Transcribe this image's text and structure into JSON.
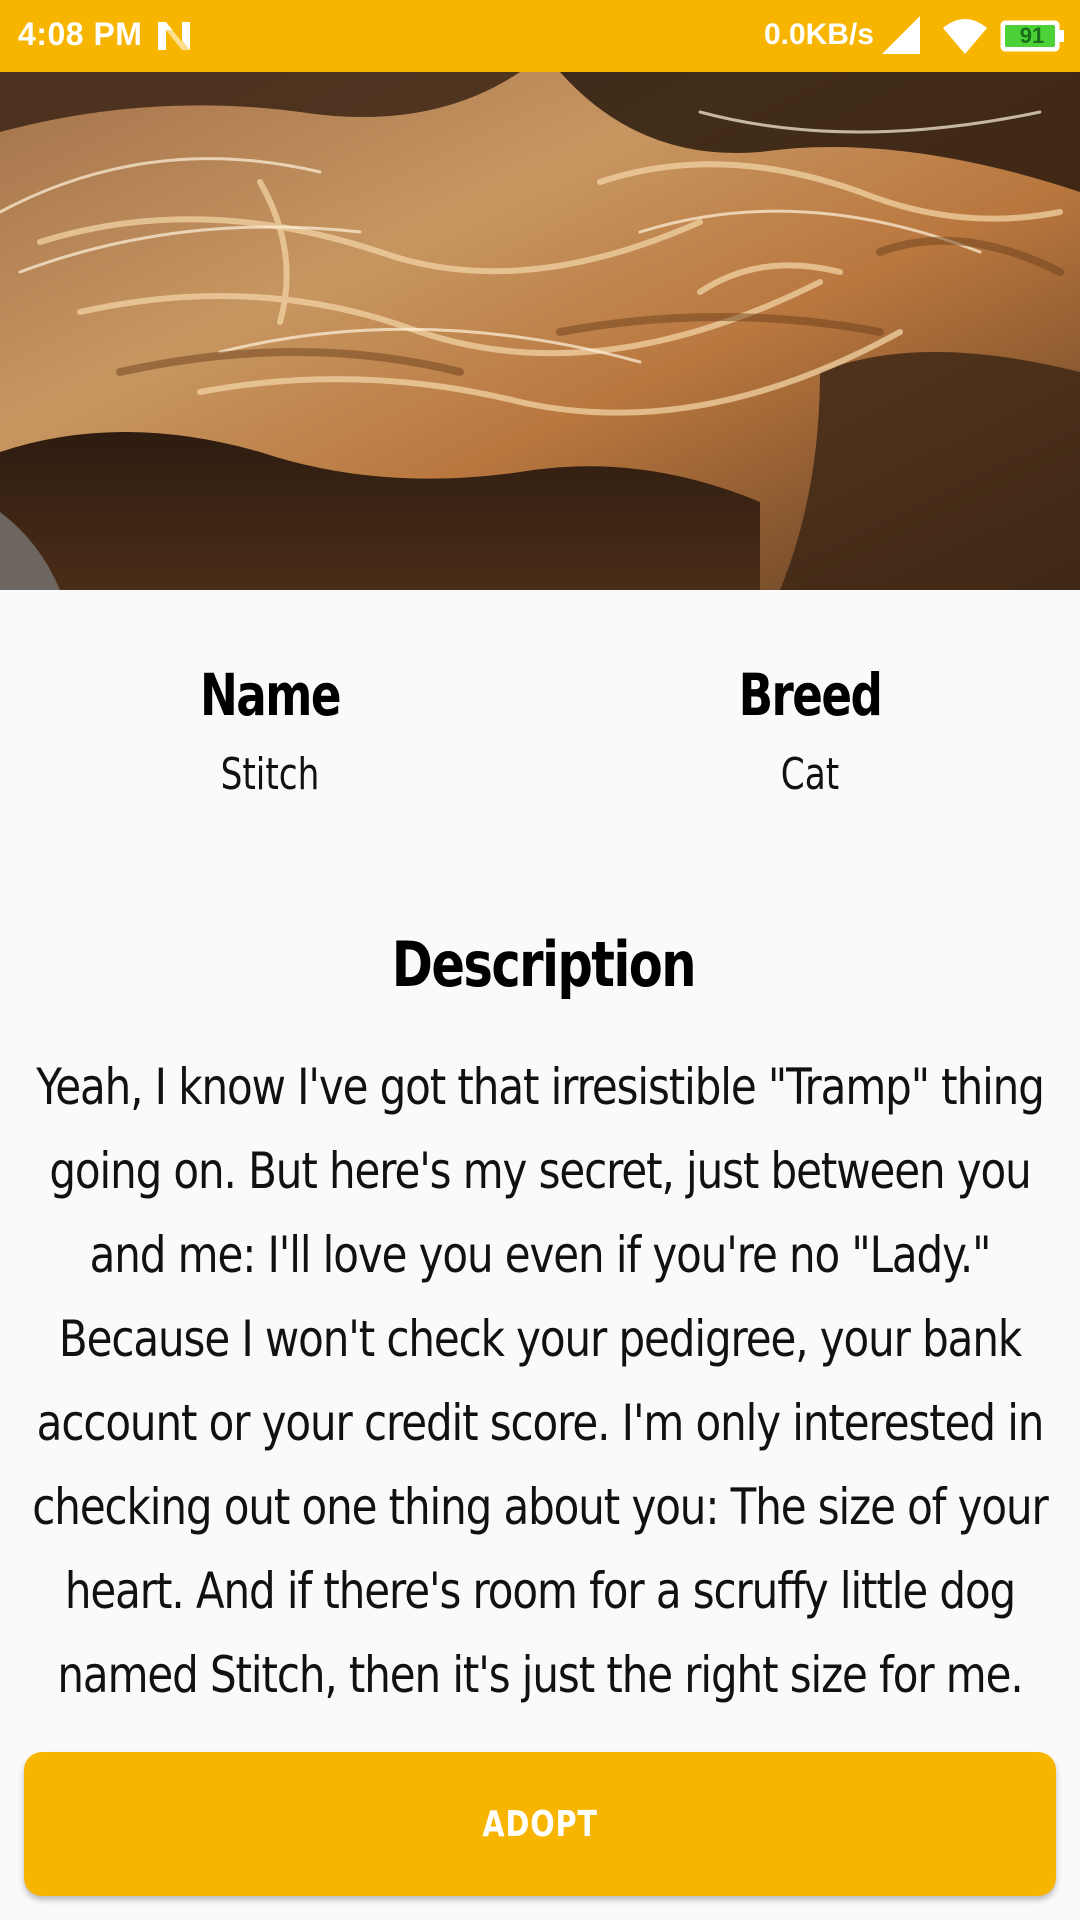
{
  "status_bar": {
    "time": "4:08 PM",
    "network_speed": "0.0KB/s",
    "battery_level": "91",
    "background_color": "#f8b500",
    "icons": [
      "n-notification-icon",
      "signal-icon",
      "wifi-icon",
      "battery-icon"
    ]
  },
  "hero": {
    "image": "cat-fur-photo"
  },
  "pet": {
    "name_label": "Name",
    "name_value": "Stitch",
    "breed_label": "Breed",
    "breed_value": "Cat"
  },
  "description": {
    "title": "Description",
    "text": "Yeah, I know I've got that irresistible \"Tramp\" thing going on. But here's my secret, just between you and me: I'll love you even if you're no \"Lady.\" Because I won't check your pedigree, your bank account or your credit score. I'm only interested in checking out one thing about you: The size of your heart. And if there's room for a scruffy little dog named Stitch, then it's just the right size for me."
  },
  "actions": {
    "adopt_label": "ADOPT",
    "accent_color": "#f8b500"
  }
}
